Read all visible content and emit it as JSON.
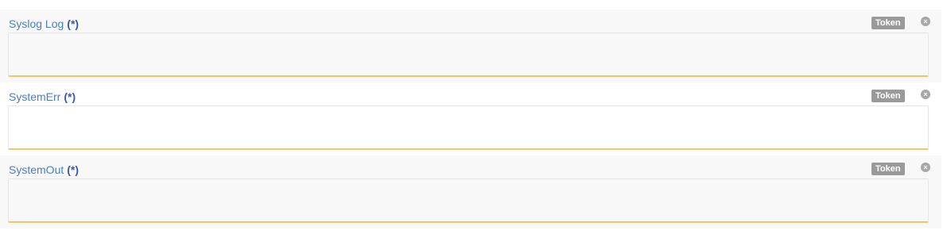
{
  "fields": [
    {
      "label": "Syslog Log",
      "required_marker": "(*)",
      "token_label": "Token",
      "remove_glyph": "×",
      "value": ""
    },
    {
      "label": "SystemErr",
      "required_marker": "(*)",
      "token_label": "Token",
      "remove_glyph": "×",
      "value": ""
    },
    {
      "label": "SystemOut",
      "required_marker": "(*)",
      "token_label": "Token",
      "remove_glyph": "×",
      "value": ""
    }
  ],
  "colors": {
    "label": "#4a7fbf",
    "required": "#3b5aa8",
    "token_badge": "#9a9a9a",
    "input_underline": "#f2c66e"
  }
}
